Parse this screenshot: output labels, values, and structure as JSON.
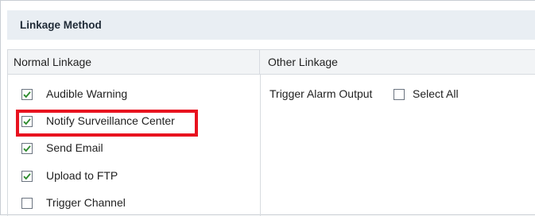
{
  "panel": {
    "title": "Linkage Method"
  },
  "columns": {
    "normal_header": "Normal Linkage",
    "other_header": "Other Linkage"
  },
  "normal_linkage": {
    "items": [
      {
        "label": "Audible Warning",
        "checked": true
      },
      {
        "label": "Notify Surveillance Center",
        "checked": true,
        "highlighted": true
      },
      {
        "label": "Send Email",
        "checked": true
      },
      {
        "label": "Upload to FTP",
        "checked": true
      },
      {
        "label": "Trigger Channel",
        "checked": false
      }
    ]
  },
  "other_linkage": {
    "trigger_alarm_output_label": "Trigger Alarm Output",
    "select_all_label": "Select All",
    "select_all_checked": false
  },
  "colors": {
    "checkmark": "#2e8b2e",
    "highlight": "#e8121f",
    "title_bar": "#e9eef3"
  }
}
